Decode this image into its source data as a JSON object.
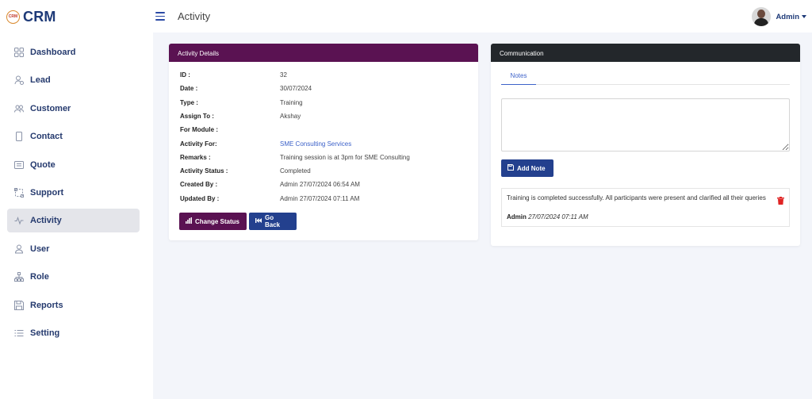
{
  "app": {
    "logo_mark": "CRM",
    "logo_text": "CRM"
  },
  "sidebar": {
    "items": [
      {
        "label": "Dashboard",
        "icon": "grid-icon"
      },
      {
        "label": "Lead",
        "icon": "user-plus-icon"
      },
      {
        "label": "Customer",
        "icon": "users-icon"
      },
      {
        "label": "Contact",
        "icon": "phone-icon"
      },
      {
        "label": "Quote",
        "icon": "document-icon"
      },
      {
        "label": "Support",
        "icon": "support-icon"
      },
      {
        "label": "Activity",
        "icon": "activity-icon",
        "active": true
      },
      {
        "label": "User",
        "icon": "user-icon"
      },
      {
        "label": "Role",
        "icon": "hierarchy-icon"
      },
      {
        "label": "Reports",
        "icon": "save-icon"
      },
      {
        "label": "Setting",
        "icon": "list-icon"
      }
    ]
  },
  "header": {
    "title": "Activity",
    "user_name": "Admin"
  },
  "details": {
    "title": "Activity Details",
    "rows": [
      {
        "key": "ID :",
        "value": "32"
      },
      {
        "key": "Date :",
        "value": "30/07/2024"
      },
      {
        "key": "Type :",
        "value": "Training"
      },
      {
        "key": "Assign To :",
        "value": "Akshay"
      },
      {
        "key": "For Module :",
        "value": ""
      },
      {
        "key": "Activity For:",
        "value": "SME Consulting Services"
      },
      {
        "key": "Remarks :",
        "value": "Training session is at 3pm for SME Consulting"
      },
      {
        "key": "Activity Status :",
        "value": "Completed"
      },
      {
        "key": "Created By :",
        "value": "Admin 27/07/2024 06:54 AM"
      },
      {
        "key": "Updated By :",
        "value": "Admin 27/07/2024 07:11 AM"
      }
    ],
    "change_status_label": "Change Status",
    "go_back_label": "Go Back"
  },
  "communication": {
    "title": "Communication",
    "tab_label": "Notes",
    "notes_value": "",
    "add_note_label": "Add Note",
    "note": {
      "text": "Training is completed successfully. All participants were present and clarified all their queries",
      "author": "Admin",
      "timestamp": "27/07/2024 07:11 AM"
    }
  },
  "colors": {
    "brand": "#1e3a78",
    "activity_header": "#5a1252",
    "communication_header": "#23272b",
    "primary_button": "#23408e",
    "link": "#3d62c9",
    "delete": "#e02424"
  }
}
